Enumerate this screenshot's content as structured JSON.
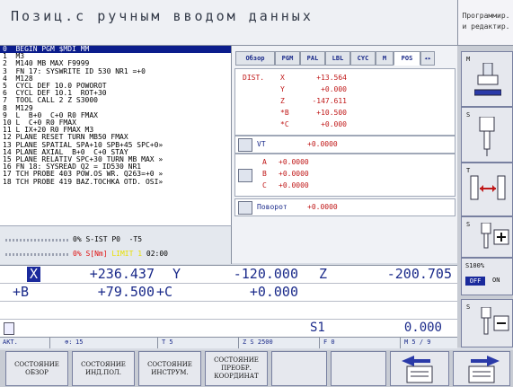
{
  "header": {
    "title": "Позиц.с ручным вводом данных",
    "mode_line1": "Программир.",
    "mode_line2": "и редактир."
  },
  "program": {
    "lines": [
      "0  BEGIN PGM $MDI MM",
      "1  M3",
      "2  M140 MB MAX F9999",
      "3  FN 17: SYSWRITE ID 530 NR1 =+0",
      "4  M128",
      "5  CYCL DEF 10.0 POWOROT",
      "6  CYCL DEF 10.1  ROT+30",
      "7  TOOL CALL 2 Z S3000",
      "8  M129",
      "9  L  B+0  C+0 R0 FMAX",
      "10 L  C+0 R0 FMAX",
      "11 L IX+20 R0 FMAX M3",
      "12 PLANE RESET TURN MB50 FMAX",
      "13 PLANE SPATIAL SPA+10 SPB+45 SPC+0»",
      "14 PLANE AXIAL  B+0  C+0 STAY",
      "15 PLANE RELATIV SPC+30 TURN MB MAX »",
      "16 FN 18: SYSREAD Q2 = ID530 NR1",
      "17 TCH PROBE 403 POW.OS WR. Q263=+0 »",
      "18 TCH PROBE 419 BAZ.TOCHKA OTD. OSI»"
    ],
    "selected_index": 0,
    "status_line1": "0% S-IST P0  -T5",
    "status_line2_pct": "0% S[Nm]",
    "status_line2_limit": "LIMIT 1",
    "status_line2_time": "02:00"
  },
  "status": {
    "tabs": [
      "Обзор",
      "PGM",
      "PAL",
      "LBL",
      "CYC",
      "M",
      "POS"
    ],
    "active_tab": "POS",
    "dist_label": "DIST.",
    "dist_rows": [
      {
        "axis": "X",
        "value": "+13.564"
      },
      {
        "axis": "Y",
        "value": "+0.000"
      },
      {
        "axis": "Z",
        "value": "-147.611"
      },
      {
        "axis": "*B",
        "value": "+10.500"
      },
      {
        "axis": "*C",
        "value": "+0.000"
      }
    ],
    "vt_label": "VT",
    "vt_value": "+0.0000",
    "abc_rows": [
      {
        "axis": "A",
        "value": "+0.0000"
      },
      {
        "axis": "B",
        "value": "+0.0000"
      },
      {
        "axis": "C",
        "value": "+0.0000"
      }
    ],
    "rot_label": "Поворот",
    "rot_value": "+0.0000"
  },
  "position": {
    "row1": {
      "x_label": "X",
      "x_val": "+236.437",
      "y_label": "Y",
      "y_val": "-120.000",
      "z_label": "Z",
      "z_val": "-200.705"
    },
    "row2": {
      "b_label": "+B",
      "b_val": "+79.500",
      "c_label": "+C",
      "c_val": "+0.000"
    },
    "s1_label": "S1",
    "s1_value": "0.000"
  },
  "infobar": {
    "mode": "АКТ.",
    "tool_pct": "15",
    "t": "T 5",
    "zs": "Z S 2500",
    "f": "F 0",
    "m": "M 5 / 9"
  },
  "softkeys": [
    {
      "l1": "СОСТОЯНИЕ",
      "l2": "ОБЗОР"
    },
    {
      "l1": "СОСТОЯНИЕ",
      "l2": "ИНД.ПОЛ."
    },
    {
      "l1": "СОСТОЯНИЕ",
      "l2": "ИНСТРУМ."
    },
    {
      "l1": "СОСТОЯНИЕ",
      "l2": "ПРЕОБР.",
      "l3": "КООРДИНАТ"
    }
  ],
  "vsoftkeys": {
    "m_label": "M",
    "s_label": "S",
    "t_label": "T",
    "s_pct": "S100%",
    "off": "OFF",
    "on": "ON"
  },
  "colors": {
    "accent_blue": "#1a2a9c",
    "dist_red": "#c01818"
  }
}
